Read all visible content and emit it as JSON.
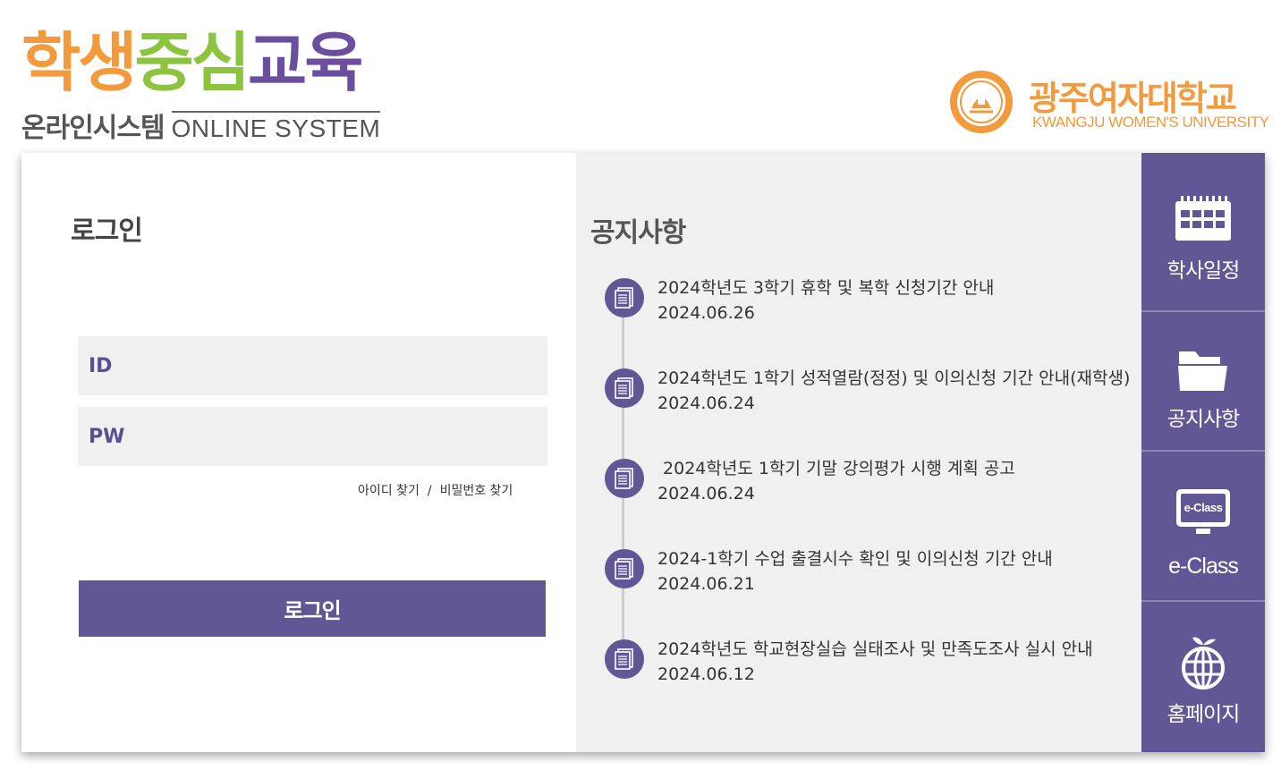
{
  "header": {
    "logo_main": [
      "학생",
      "중심",
      "교육"
    ],
    "logo_sub_ko": "온라인시스템",
    "logo_sub_en": "ONLINE SYSTEM",
    "university_ko": "광주여자대학교",
    "university_en": "KWANGJU WOMEN'S UNIVERSITY"
  },
  "login": {
    "title": "로그인",
    "id_placeholder": "ID",
    "pw_placeholder": "PW",
    "find_id": "아이디 찾기",
    "separator": "/",
    "find_pw": "비밀번호 찾기",
    "button_label": "로그인"
  },
  "notices": {
    "title": "공지사항",
    "items": [
      {
        "text": "2024학년도 3학기 휴학 및 복학 신청기간 안내",
        "date": "2024.06.26"
      },
      {
        "text": "2024학년도 1학기 성적열람(정정) 및 이의신청 기간 안내(재학생)",
        "date": "2024.06.24"
      },
      {
        "text": " 2024학년도 1학기 기말 강의평가 시행 계획 공고",
        "date": "2024.06.24"
      },
      {
        "text": "2024-1학기 수업 출결시수 확인 및 이의신청 기간 안내",
        "date": "2024.06.21"
      },
      {
        "text": "2024학년도 학교현장실습 실태조사 및 만족도조사 실시 안내",
        "date": "2024.06.12"
      }
    ]
  },
  "side_nav": {
    "items": [
      {
        "label": "학사일정",
        "icon": "calendar-icon"
      },
      {
        "label": "공지사항",
        "icon": "folder-icon"
      },
      {
        "label": "e-Class",
        "icon": "eclass-monitor-icon",
        "icon_text": "e-Class"
      },
      {
        "label": "홈페이지",
        "icon": "globe-apple-icon"
      }
    ]
  },
  "colors": {
    "brand_purple": "#625794",
    "logo_orange": "#f39a3d",
    "logo_green": "#8cc43f",
    "logo_purple": "#6b4f9f",
    "panel_gray": "#f0f0f0"
  }
}
